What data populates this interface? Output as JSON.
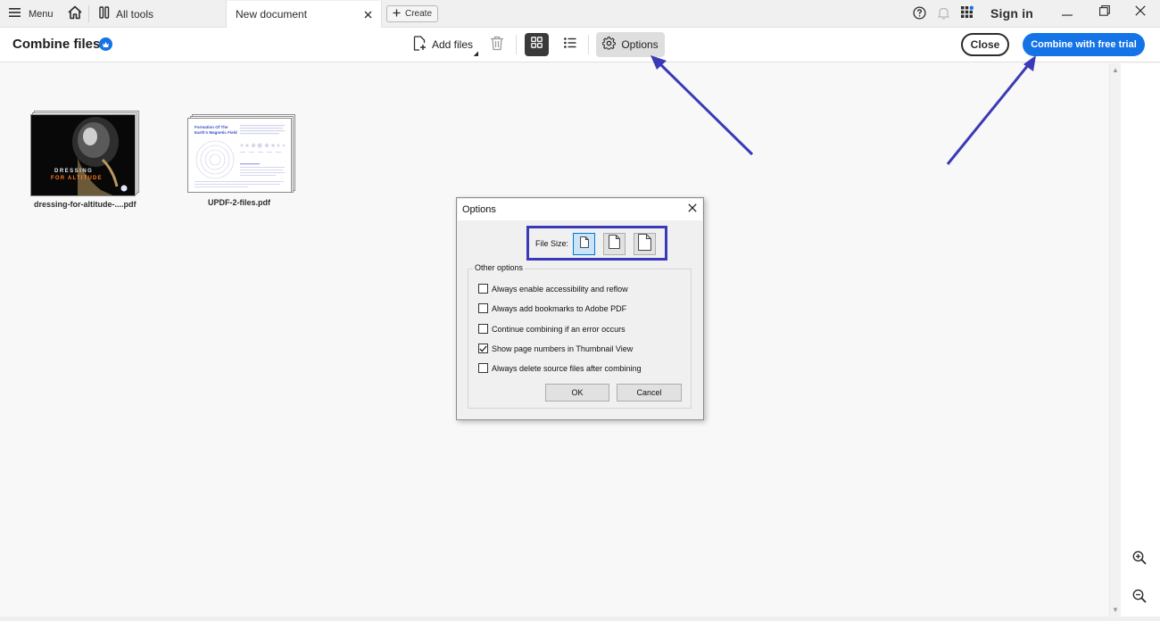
{
  "topbar": {
    "menu_label": "Menu",
    "all_tools_label": "All tools",
    "tab_label": "New document",
    "create_label": "Create",
    "sign_in_label": "Sign in"
  },
  "toolbar": {
    "title": "Combine files",
    "add_files_label": "Add files",
    "options_label": "Options",
    "close_label": "Close",
    "combine_label": "Combine with free trial"
  },
  "files": [
    {
      "name": "dressing-for-altitude-....pdf",
      "cover_line1": "DRESSING",
      "cover_line2": "FOR ALTITUDE"
    },
    {
      "name": "UPDF-2-files.pdf",
      "cover_title": "Formation Of The Earth's Magnetic Field"
    }
  ],
  "dialog": {
    "title": "Options",
    "file_size_label": "File Size:",
    "other_options_label": "Other options",
    "options": [
      {
        "label": "Always enable accessibility and reflow",
        "checked": false
      },
      {
        "label": "Always add bookmarks to Adobe PDF",
        "checked": false
      },
      {
        "label": "Continue combining if an error occurs",
        "checked": false
      },
      {
        "label": "Show page numbers in Thumbnail View",
        "checked": true
      },
      {
        "label": "Always delete source files after combining",
        "checked": false
      }
    ],
    "ok_label": "OK",
    "cancel_label": "Cancel"
  },
  "colors": {
    "accent": "#1473e6",
    "annotation": "#3a3ab8",
    "active_grid_button": "#3a3a3a"
  },
  "icons": [
    "menu-icon",
    "home-icon",
    "all-tools-icon",
    "close-icon",
    "plus-icon",
    "help-icon",
    "bell-icon",
    "apps-icon",
    "minimize-icon",
    "restore-icon",
    "add-file-icon",
    "trash-icon",
    "grid-view-icon",
    "list-view-icon",
    "gear-icon",
    "zoom-in-icon",
    "zoom-out-icon",
    "file-size-small-icon",
    "file-size-medium-icon",
    "file-size-large-icon"
  ]
}
